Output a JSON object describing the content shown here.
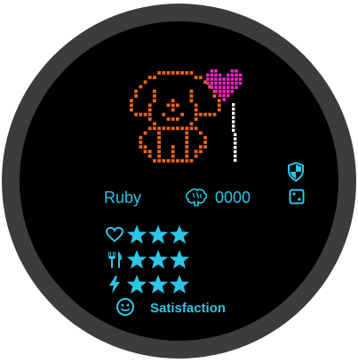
{
  "pet": {
    "name": "Ruby",
    "points": "0000",
    "status": "Satisfaction"
  },
  "stats": [
    {
      "icon": "heart-outline-icon",
      "key": "happiness",
      "level": 3,
      "max": 3
    },
    {
      "icon": "fork-knife-icon",
      "key": "hunger",
      "level": 3,
      "max": 3
    },
    {
      "icon": "lightning-icon",
      "key": "energy",
      "level": 3,
      "max": 3
    }
  ],
  "icons": {
    "brain": "brain-icon",
    "shield": "shield-icon",
    "dice": "dice-icon",
    "smiley": "smiley-icon"
  },
  "colors": {
    "accent": "#2dc5e8",
    "pet": "#e8641e",
    "balloon": "#e826c8",
    "background": "#000000",
    "bezel": "#3c3c3c"
  }
}
